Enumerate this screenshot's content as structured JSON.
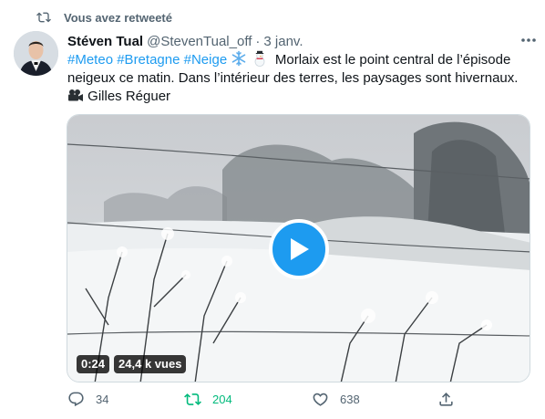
{
  "retweet_banner": {
    "text": "Vous avez retweeté",
    "icon": "retweet-icon"
  },
  "author": {
    "name": "Stéven Tual",
    "handle": "@StevenTual_off",
    "separator": "·",
    "date": "3 janv."
  },
  "tweet": {
    "hashtags": [
      "#Meteo",
      "#Bretagne",
      "#Neige"
    ],
    "emojis": [
      "snowflake-icon",
      "snowman-icon"
    ],
    "line1_text": "Morlaix est le point central de l’épisode",
    "line2_text": "neigeux ce matin. Dans l’intérieur des terres, les paysages sont hivernaux.",
    "credit_icon": "video-camera-icon",
    "credit_text": "Gilles Réguer"
  },
  "video": {
    "duration": "0:24",
    "views": "24,4 k vues",
    "play_icon": "play-icon"
  },
  "actions": {
    "reply_count": "34",
    "retweet_count": "204",
    "like_count": "638"
  },
  "colors": {
    "accent": "#1d9bf0",
    "retweet_active": "#00ba7c",
    "muted": "#536471"
  }
}
